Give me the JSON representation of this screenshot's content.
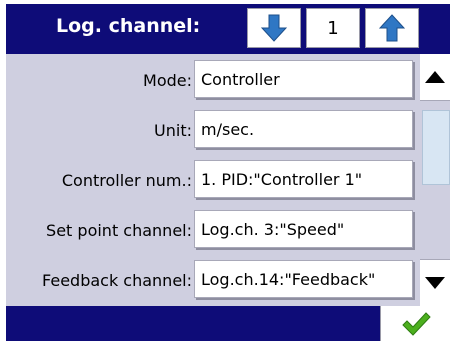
{
  "header": {
    "title": "Log. channel:",
    "channel_number": "1",
    "down_icon": "arrow-down-icon",
    "up_icon": "arrow-up-icon"
  },
  "rows": [
    {
      "label": "Mode:",
      "value": "Controller"
    },
    {
      "label": "Unit:",
      "value": "m/sec."
    },
    {
      "label": "Controller num.:",
      "value": "1. PID:\"Controller 1\""
    },
    {
      "label": "Set point channel:",
      "value": "Log.ch. 3:\"Speed\""
    },
    {
      "label": "Feedback channel:",
      "value": "Log.ch.14:\"Feedback\""
    }
  ],
  "scrollbar": {
    "up_icon": "triangle-up-icon",
    "down_icon": "triangle-down-icon"
  },
  "footer": {
    "ok_icon": "checkmark-icon"
  },
  "colors": {
    "header_bg": "#0e0c78",
    "panel_bg": "#cfcfe0",
    "arrow_blue": "#2f77c4",
    "check_green": "#4caf1e"
  }
}
